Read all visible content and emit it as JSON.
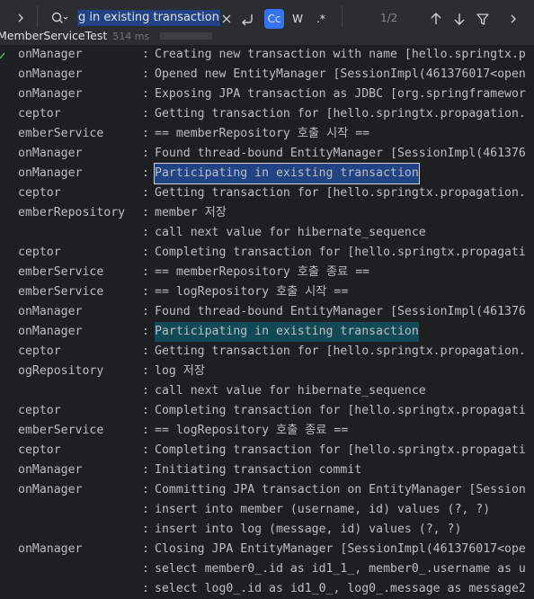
{
  "search": {
    "query": "g in existing transaction",
    "match_counter": "1/2",
    "case_label": "Cc",
    "word_label": "W",
    "regex_label": ".*"
  },
  "icons": {
    "left_arrow": "chevron-right-icon",
    "search": "search-icon",
    "clear": "close-icon",
    "newline": "newline-icon",
    "up": "arrow-up-icon",
    "down": "arrow-down-icon",
    "filter": "filter-icon",
    "more": "chevron-right-icon"
  },
  "test": {
    "name": "MemberServiceTest",
    "duration": "514 ms"
  },
  "log_lines": [
    {
      "logger": "onManager",
      "message": "Creating new transaction with name [hello.springtx.p"
    },
    {
      "logger": "onManager",
      "message": "Opened new EntityManager [SessionImpl(461376017<open"
    },
    {
      "logger": "onManager",
      "message": "Exposing JPA transaction as JDBC [org.springframewor"
    },
    {
      "logger": "ceptor",
      "message": "Getting transaction for [hello.springtx.propagation."
    },
    {
      "logger": "emberService",
      "message": "== memberRepository 호출 시작 =="
    },
    {
      "logger": "onManager",
      "message": "Found thread-bound EntityManager [SessionImpl(461376"
    },
    {
      "logger": "onManager",
      "message": "Participating in existing transaction",
      "highlight": "current"
    },
    {
      "logger": "ceptor",
      "message": "Getting transaction for [hello.springtx.propagation."
    },
    {
      "logger": "emberRepository",
      "message": "member 저장"
    },
    {
      "logger": "",
      "message": "call next value for hibernate_sequence"
    },
    {
      "logger": "ceptor",
      "message": "Completing transaction for [hello.springtx.propagati"
    },
    {
      "logger": "emberService",
      "message": "== memberRepository 호출 종료 =="
    },
    {
      "logger": "emberService",
      "message": "== logRepository 호출 시작 =="
    },
    {
      "logger": "onManager",
      "message": "Found thread-bound EntityManager [SessionImpl(461376"
    },
    {
      "logger": "onManager",
      "message": "Participating in existing transaction",
      "highlight": "other"
    },
    {
      "logger": "ceptor",
      "message": "Getting transaction for [hello.springtx.propagation."
    },
    {
      "logger": "ogRepository",
      "message": "log 저장"
    },
    {
      "logger": "",
      "message": "call next value for hibernate_sequence"
    },
    {
      "logger": "ceptor",
      "message": "Completing transaction for [hello.springtx.propagati"
    },
    {
      "logger": "emberService",
      "message": "== logRepository 호출 종료 =="
    },
    {
      "logger": "ceptor",
      "message": "Completing transaction for [hello.springtx.propagati"
    },
    {
      "logger": "onManager",
      "message": "Initiating transaction commit"
    },
    {
      "logger": "onManager",
      "message": "Committing JPA transaction on EntityManager [Session"
    },
    {
      "logger": "",
      "message": "insert into member (username, id) values (?, ?)"
    },
    {
      "logger": "",
      "message": "insert into log (message, id) values (?, ?)"
    },
    {
      "logger": "onManager",
      "message": "Closing JPA EntityManager [SessionImpl(461376017<ope"
    },
    {
      "logger": "",
      "message": "select member0_.id as id1_1_, member0_.username as u"
    },
    {
      "logger": "",
      "message": "select log0_.id as id1_0_, log0_.message as message2"
    }
  ],
  "colors": {
    "background": "#1e1f22",
    "toolbar": "#2b2d30",
    "current_match": "#214283",
    "other_match": "#114957",
    "toggle_active": "#3574f0"
  }
}
